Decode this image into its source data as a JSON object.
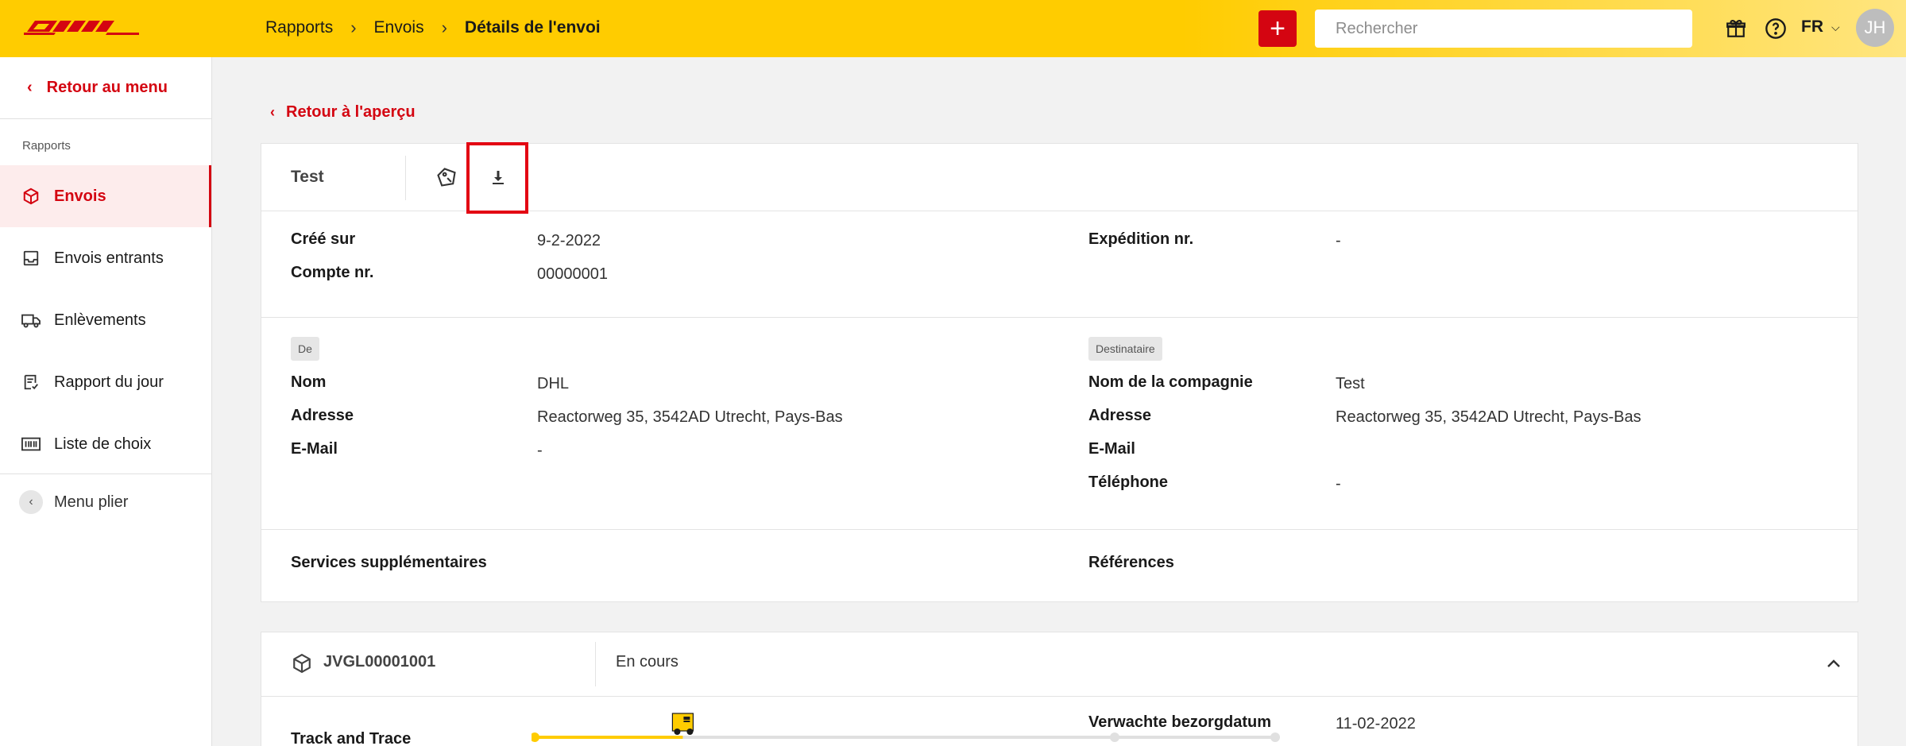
{
  "header": {
    "logo_text": "DHL",
    "breadcrumb": [
      "Rapports",
      "Envois",
      "Détails de l'envoi"
    ],
    "add_label": "+",
    "search_placeholder": "Rechercher",
    "language": "FR",
    "avatar_initials": "JH",
    "colors": {
      "brand_yellow": "#ffcc00",
      "brand_red": "#d40511"
    }
  },
  "sidebar": {
    "back_label": "Retour au menu",
    "section_label": "Rapports",
    "items": [
      {
        "label": "Envois",
        "icon": "package-icon",
        "active": true
      },
      {
        "label": "Envois entrants",
        "icon": "inbox-icon",
        "active": false
      },
      {
        "label": "Enlèvements",
        "icon": "truck-icon",
        "active": false
      },
      {
        "label": "Rapport du jour",
        "icon": "report-icon",
        "active": false
      },
      {
        "label": "Liste de choix",
        "icon": "barcode-icon",
        "active": false
      }
    ],
    "collapse_label": "Menu plier"
  },
  "main": {
    "back_link": "Retour à l'aperçu",
    "shipment": {
      "title": "Test",
      "actions": [
        "label-icon",
        "download-icon"
      ],
      "created_label": "Créé sur",
      "created_value": "9-2-2022",
      "account_label": "Compte nr.",
      "account_value": "00000001",
      "expedition_label": "Expédition nr.",
      "expedition_value": "-",
      "sender": {
        "tag": "De",
        "name_label": "Nom",
        "name_value": "DHL",
        "address_label": "Adresse",
        "address_value": "Reactorweg 35, 3542AD Utrecht, Pays-Bas",
        "email_label": "E-Mail",
        "email_value": "-"
      },
      "recipient": {
        "tag": "Destinataire",
        "company_label": "Nom de la compagnie",
        "company_value": "Test",
        "address_label": "Adresse",
        "address_value": "Reactorweg 35, 3542AD Utrecht, Pays-Bas",
        "email_label": "E-Mail",
        "email_value": "",
        "phone_label": "Téléphone",
        "phone_value": "-"
      },
      "services_label": "Services supplémentaires",
      "references_label": "Références"
    },
    "package": {
      "id": "JVGL00001001",
      "status": "En cours",
      "track_label": "Track and Trace",
      "track_progress": 0.2,
      "expected_label": "Verwachte bezorgdatum",
      "expected_value": "11-02-2022"
    }
  }
}
